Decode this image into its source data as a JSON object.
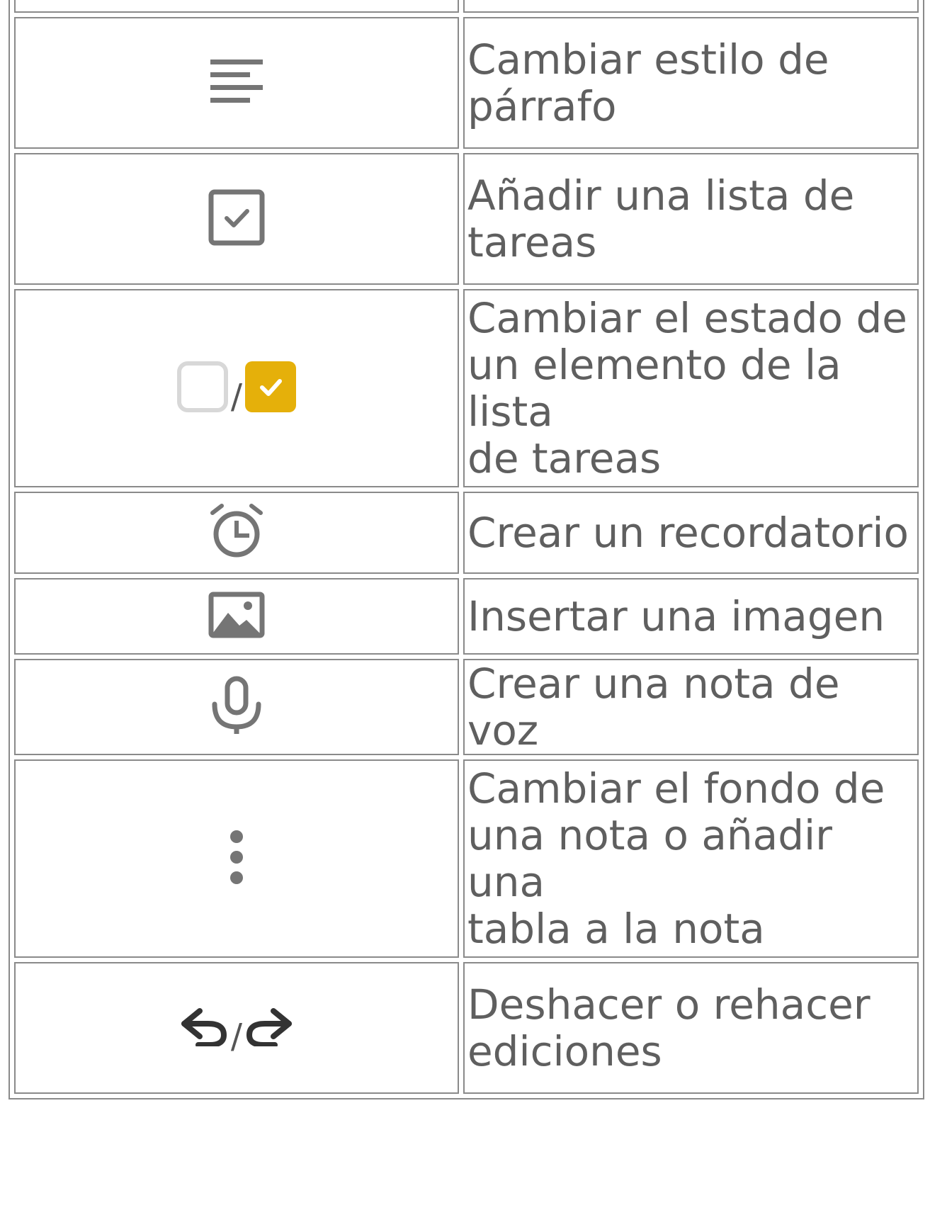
{
  "table": {
    "rows": [
      {
        "icon": "paragraph-style-icon",
        "text": "Cambiar estilo de\npárrafo"
      },
      {
        "icon": "checklist-icon",
        "text": "Añadir una lista de\ntareas"
      },
      {
        "icon": "checkbox-toggle-icon",
        "separator": "/",
        "text": "Cambiar el estado de\nun elemento de la lista\nde tareas"
      },
      {
        "icon": "alarm-clock-icon",
        "text": "Crear un recordatorio"
      },
      {
        "icon": "image-icon",
        "text": "Insertar una imagen"
      },
      {
        "icon": "microphone-icon",
        "text": "Crear una nota de voz"
      },
      {
        "icon": "more-vertical-icon",
        "text": "Cambiar el fondo de\nuna nota o añadir una\ntabla a la nota"
      },
      {
        "icon": "undo-redo-icon",
        "separator": "/",
        "text": "Deshacer o rehacer\nediciones"
      }
    ]
  },
  "colors": {
    "icon_gray": "#757575",
    "checkbox_checked": "#e5b00a",
    "checkbox_empty": "#d8d8d8",
    "text": "#5f5f5f",
    "border": "#8a8a8a"
  }
}
